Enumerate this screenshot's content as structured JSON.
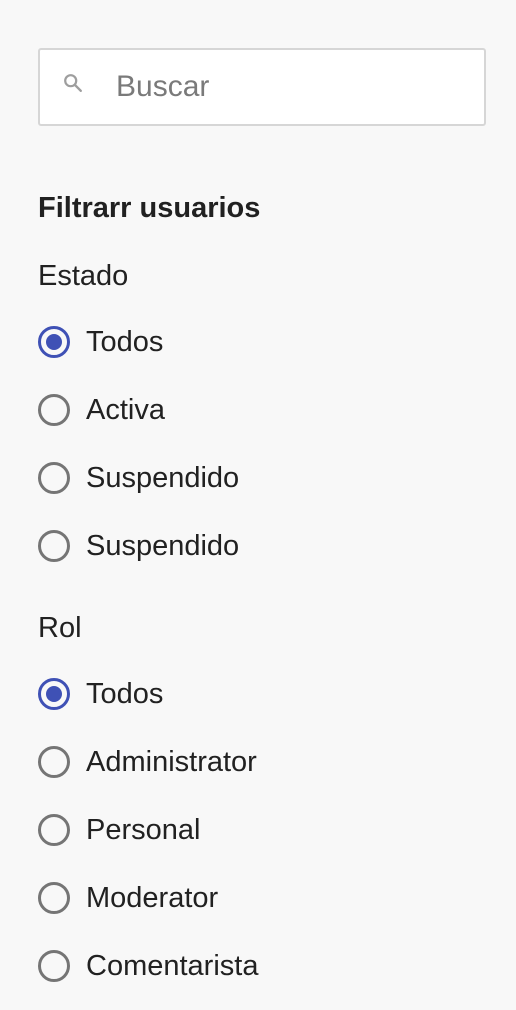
{
  "search": {
    "placeholder": "Buscar",
    "value": ""
  },
  "filters": {
    "heading": "Filtrarr usuarios",
    "estado": {
      "label": "Estado",
      "options": [
        {
          "label": "Todos",
          "checked": true
        },
        {
          "label": "Activa",
          "checked": false
        },
        {
          "label": "Suspendido",
          "checked": false
        },
        {
          "label": "Suspendido",
          "checked": false
        }
      ]
    },
    "rol": {
      "label": "Rol",
      "options": [
        {
          "label": "Todos",
          "checked": true
        },
        {
          "label": "Administrator",
          "checked": false
        },
        {
          "label": "Personal",
          "checked": false
        },
        {
          "label": "Moderator",
          "checked": false
        },
        {
          "label": "Comentarista",
          "checked": false
        }
      ]
    }
  },
  "colors": {
    "accent": "#3f51b5",
    "radio_unchecked": "#757575",
    "background": "#f8f8f8"
  }
}
